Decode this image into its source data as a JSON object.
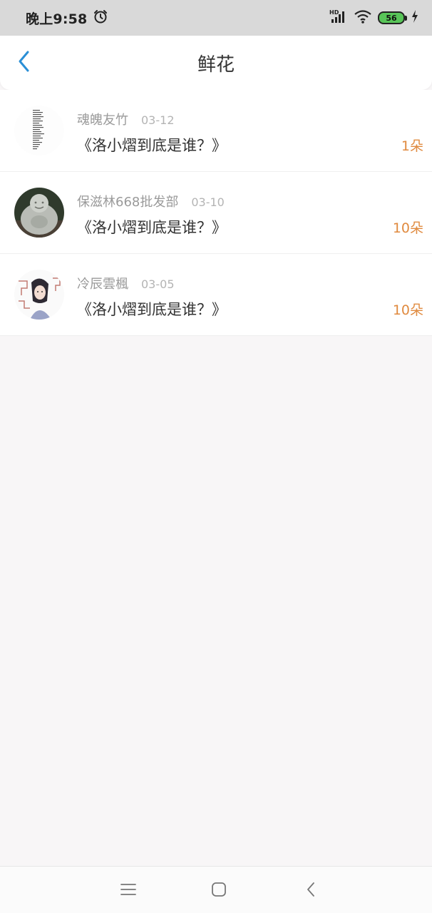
{
  "status_bar": {
    "time": "晚上9:58",
    "battery": "56",
    "icons": [
      "alarm-icon",
      "hd-signal-icon",
      "wifi-icon",
      "battery-icon",
      "charging-icon"
    ]
  },
  "header": {
    "title": "鲜花",
    "back_icon": "chevron-left-icon",
    "accent_color": "#2a8fd6"
  },
  "list": {
    "items": [
      {
        "user": "魂魄友竹",
        "date": "03-12",
        "book": "《洛小熠到底是谁？》",
        "count": "1朵"
      },
      {
        "user": "保滋林668批发部",
        "date": "03-10",
        "book": "《洛小熠到底是谁？》",
        "count": "10朵"
      },
      {
        "user": "冷辰雲楓",
        "date": "03-05",
        "book": "《洛小熠到底是谁？》",
        "count": "10朵"
      }
    ],
    "count_color": "#e08a3f"
  },
  "nav_bar": {
    "icons": [
      "menu-icon",
      "home-icon",
      "back-icon"
    ]
  }
}
